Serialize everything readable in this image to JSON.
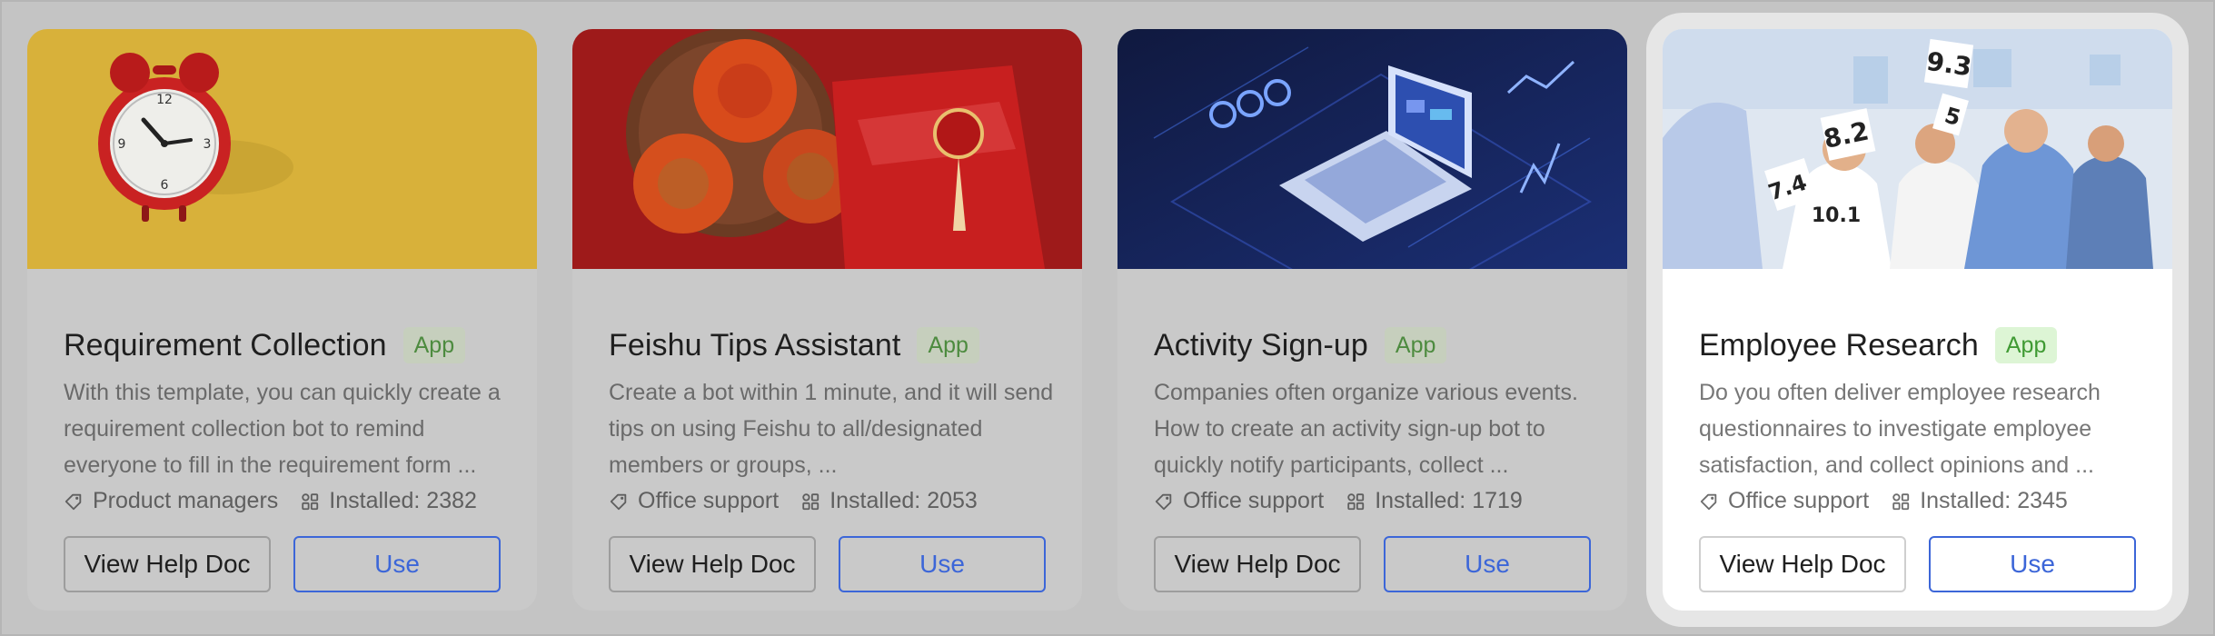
{
  "cards": [
    {
      "title": "Requirement Collection",
      "badge": "App",
      "description": "With this template, you can quickly create a requirement collection bot to remind everyone to fill in the requirement form ...",
      "category": "Product managers",
      "installs": "Installed: 2382",
      "help_label": "View Help Doc",
      "use_label": "Use",
      "image": "alarm-clock-on-yellow-background",
      "image_colors": [
        "#d8b13a",
        "#d11f1f",
        "#eeeeee"
      ]
    },
    {
      "title": "Feishu Tips Assistant",
      "badge": "App",
      "description": "Create a bot within 1 minute, and it will send tips on using Feishu to all/designated members or groups, ...",
      "category": "Office support",
      "installs": "Installed: 2053",
      "help_label": "View Help Doc",
      "use_label": "Use",
      "image": "persimmons-and-red-envelope",
      "image_colors": [
        "#9e1a1a",
        "#c92121",
        "#e56a1c"
      ]
    },
    {
      "title": "Activity Sign-up",
      "badge": "App",
      "description": "Companies often organize various events. How to create an activity sign-up bot to quickly notify participants, collect ...",
      "category": "Office support",
      "installs": "Installed: 1719",
      "help_label": "View Help Doc",
      "use_label": "Use",
      "image": "isometric-laptop-data-graphics",
      "image_colors": [
        "#15214d",
        "#2449a6",
        "#8fb3ff"
      ]
    },
    {
      "title": "Employee Research",
      "badge": "App",
      "description": "Do you often deliver employee research questionnaires to investigate employee satisfaction, and collect opinions and ...",
      "category": "Office support",
      "installs": "Installed: 2345",
      "help_label": "View Help Doc",
      "use_label": "Use",
      "image": "people-holding-score-cards",
      "image_colors": [
        "#d9e3ef",
        "#4f77bb",
        "#ffffff"
      ],
      "score_cards": [
        "9.3",
        "8.2",
        "7.4",
        "5",
        "10.1"
      ]
    }
  ],
  "colors": {
    "accent": "#3c66d8",
    "badge_text": "#4d8b3f",
    "badge_bg_active": "#ddf5d5"
  },
  "icons": {
    "tag": "tag-icon",
    "installs": "grid-icon"
  }
}
